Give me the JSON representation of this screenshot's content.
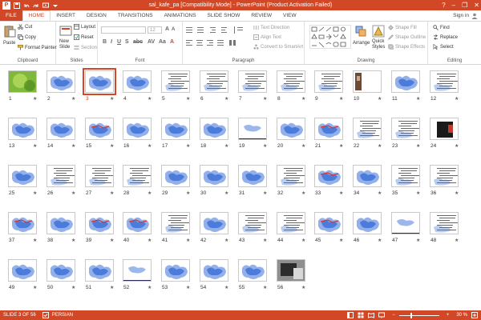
{
  "window": {
    "title": "sal_kafe_pa [Compatibility Mode] - PowerPoint (Product Activation Failed)",
    "app_icon": "P",
    "minimize": "–",
    "restore": "❐",
    "close": "✕",
    "help": "?"
  },
  "qat": {
    "save": "save-icon",
    "undo": "undo-icon",
    "redo": "redo-icon",
    "present": "present-icon",
    "customize": "customize-icon"
  },
  "tabs": [
    "FILE",
    "HOME",
    "INSERT",
    "DESIGN",
    "TRANSITIONS",
    "ANIMATIONS",
    "SLIDE SHOW",
    "REVIEW",
    "VIEW"
  ],
  "signin": "Sign in",
  "ribbon": {
    "clipboard": {
      "paste": "Paste",
      "cut": "Cut",
      "copy": "Copy",
      "format_painter": "Format Painter",
      "label": "Clipboard"
    },
    "slides": {
      "new_slide": "New",
      "new_slide2": "Slide",
      "layout": "Layout",
      "reset": "Reset",
      "section": "Section",
      "label": "Slides"
    },
    "font": {
      "font_name": "",
      "font_size": "12",
      "label": "Font"
    },
    "paragraph": {
      "text_direction": "Text Direction",
      "align_text": "Align Text",
      "smartart": "Convert to SmartArt",
      "label": "Paragraph"
    },
    "drawing": {
      "arrange": "Arrange",
      "quick_styles": "Quick",
      "quick_styles2": "Styles",
      "shape_fill": "Shape Fill",
      "shape_outline": "Shape Outline",
      "shape_effects": "Shape Effects",
      "label": "Drawing"
    },
    "editing": {
      "find": "Find",
      "replace": "Replace",
      "select": "Select",
      "label": "Editing"
    }
  },
  "slides": [
    {
      "n": "1",
      "kind": "green"
    },
    {
      "n": "2",
      "kind": "map"
    },
    {
      "n": "3",
      "kind": "map",
      "selected": true
    },
    {
      "n": "4",
      "kind": "map"
    },
    {
      "n": "5",
      "kind": "text"
    },
    {
      "n": "6",
      "kind": "text"
    },
    {
      "n": "7",
      "kind": "text"
    },
    {
      "n": "8",
      "kind": "text"
    },
    {
      "n": "9",
      "kind": "text"
    },
    {
      "n": "10",
      "kind": "photo"
    },
    {
      "n": "11",
      "kind": "map"
    },
    {
      "n": "12",
      "kind": "text"
    },
    {
      "n": "13",
      "kind": "map"
    },
    {
      "n": "14",
      "kind": "map"
    },
    {
      "n": "15",
      "kind": "mapred"
    },
    {
      "n": "16",
      "kind": "map"
    },
    {
      "n": "17",
      "kind": "map"
    },
    {
      "n": "18",
      "kind": "map"
    },
    {
      "n": "19",
      "kind": "bar"
    },
    {
      "n": "20",
      "kind": "map"
    },
    {
      "n": "21",
      "kind": "mapred"
    },
    {
      "n": "22",
      "kind": "text"
    },
    {
      "n": "23",
      "kind": "text"
    },
    {
      "n": "24",
      "kind": "dark"
    },
    {
      "n": "25",
      "kind": "map"
    },
    {
      "n": "26",
      "kind": "text"
    },
    {
      "n": "27",
      "kind": "text"
    },
    {
      "n": "28",
      "kind": "text"
    },
    {
      "n": "29",
      "kind": "map"
    },
    {
      "n": "30",
      "kind": "map"
    },
    {
      "n": "31",
      "kind": "map"
    },
    {
      "n": "32",
      "kind": "text"
    },
    {
      "n": "33",
      "kind": "mapred"
    },
    {
      "n": "34",
      "kind": "map"
    },
    {
      "n": "35",
      "kind": "text"
    },
    {
      "n": "36",
      "kind": "text"
    },
    {
      "n": "37",
      "kind": "mapred"
    },
    {
      "n": "38",
      "kind": "map"
    },
    {
      "n": "39",
      "kind": "mapred"
    },
    {
      "n": "40",
      "kind": "mapred"
    },
    {
      "n": "41",
      "kind": "text"
    },
    {
      "n": "42",
      "kind": "map"
    },
    {
      "n": "43",
      "kind": "text"
    },
    {
      "n": "44",
      "kind": "text"
    },
    {
      "n": "45",
      "kind": "mapred"
    },
    {
      "n": "46",
      "kind": "map"
    },
    {
      "n": "47",
      "kind": "bar"
    },
    {
      "n": "48",
      "kind": "text"
    },
    {
      "n": "49",
      "kind": "map"
    },
    {
      "n": "50",
      "kind": "map"
    },
    {
      "n": "51",
      "kind": "map"
    },
    {
      "n": "52",
      "kind": "bar"
    },
    {
      "n": "53",
      "kind": "map"
    },
    {
      "n": "54",
      "kind": "map"
    },
    {
      "n": "55",
      "kind": "map"
    },
    {
      "n": "56",
      "kind": "photo2"
    }
  ],
  "star": "★",
  "status": {
    "slide": "SLIDE 3 OF 56",
    "language": "PERSIAN",
    "zoom": "30 %",
    "zoom_fraction": 0.3
  },
  "colors": {
    "accent": "#d24726",
    "map_blue": "#3a6fd8"
  }
}
